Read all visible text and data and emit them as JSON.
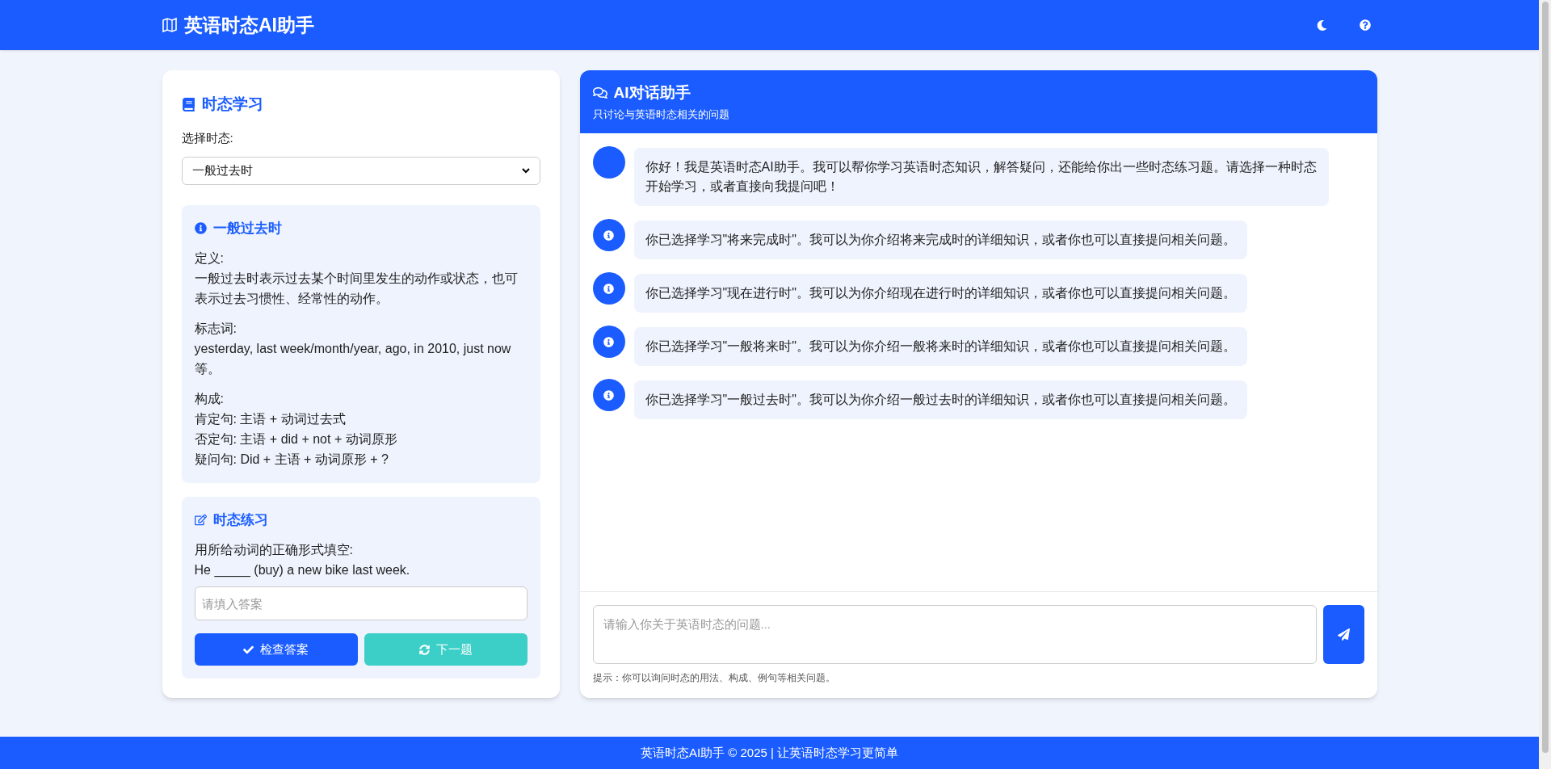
{
  "header": {
    "title": "英语时态AI助手"
  },
  "learning": {
    "title": "时态学习",
    "select_label": "选择时态:",
    "selected_tense": "一般过去时",
    "info": {
      "title": "一般过去时",
      "sections": [
        {
          "label": "定义:",
          "lines": [
            "一般过去时表示过去某个时间里发生的动作或状态，也可表示过去习惯性、经常性的动作。"
          ]
        },
        {
          "label": "标志词:",
          "lines": [
            "yesterday, last week/month/year, ago, in 2010, just now等。"
          ]
        },
        {
          "label": "构成:",
          "lines": [
            "肯定句: 主语 + 动词过去式",
            "否定句: 主语 + did + not + 动词原形",
            "疑问句: Did + 主语 + 动词原形 + ?"
          ]
        }
      ]
    },
    "practice": {
      "title": "时态练习",
      "instruction": "用所给动词的正确形式填空:",
      "question": "He _____ (buy) a new bike last week.",
      "answer_placeholder": "请填入答案",
      "check_button": "检查答案",
      "next_button": "下一题"
    }
  },
  "chat": {
    "title": "AI对话助手",
    "subtitle": "只讨论与英语时态相关的问题",
    "messages": [
      {
        "kind": "plain",
        "text": "你好！我是英语时态AI助手。我可以帮你学习英语时态知识，解答疑问，还能给你出一些时态练习题。请选择一种时态开始学习，或者直接向我提问吧！"
      },
      {
        "kind": "info",
        "text": "你已选择学习\"将来完成时\"。我可以为你介绍将来完成时的详细知识，或者你也可以直接提问相关问题。"
      },
      {
        "kind": "info",
        "text": "你已选择学习\"现在进行时\"。我可以为你介绍现在进行时的详细知识，或者你也可以直接提问相关问题。"
      },
      {
        "kind": "info",
        "text": "你已选择学习\"一般将来时\"。我可以为你介绍一般将来时的详细知识，或者你也可以直接提问相关问题。"
      },
      {
        "kind": "info",
        "text": "你已选择学习\"一般过去时\"。我可以为你介绍一般过去时的详细知识，或者你也可以直接提问相关问题。"
      }
    ],
    "input_placeholder": "请输入你关于英语时态的问题...",
    "hint": "提示：你可以询问时态的用法、构成、例句等相关问题。"
  },
  "footer": {
    "text": "英语时态AI助手 © 2025 | 让英语时态学习更简单"
  }
}
